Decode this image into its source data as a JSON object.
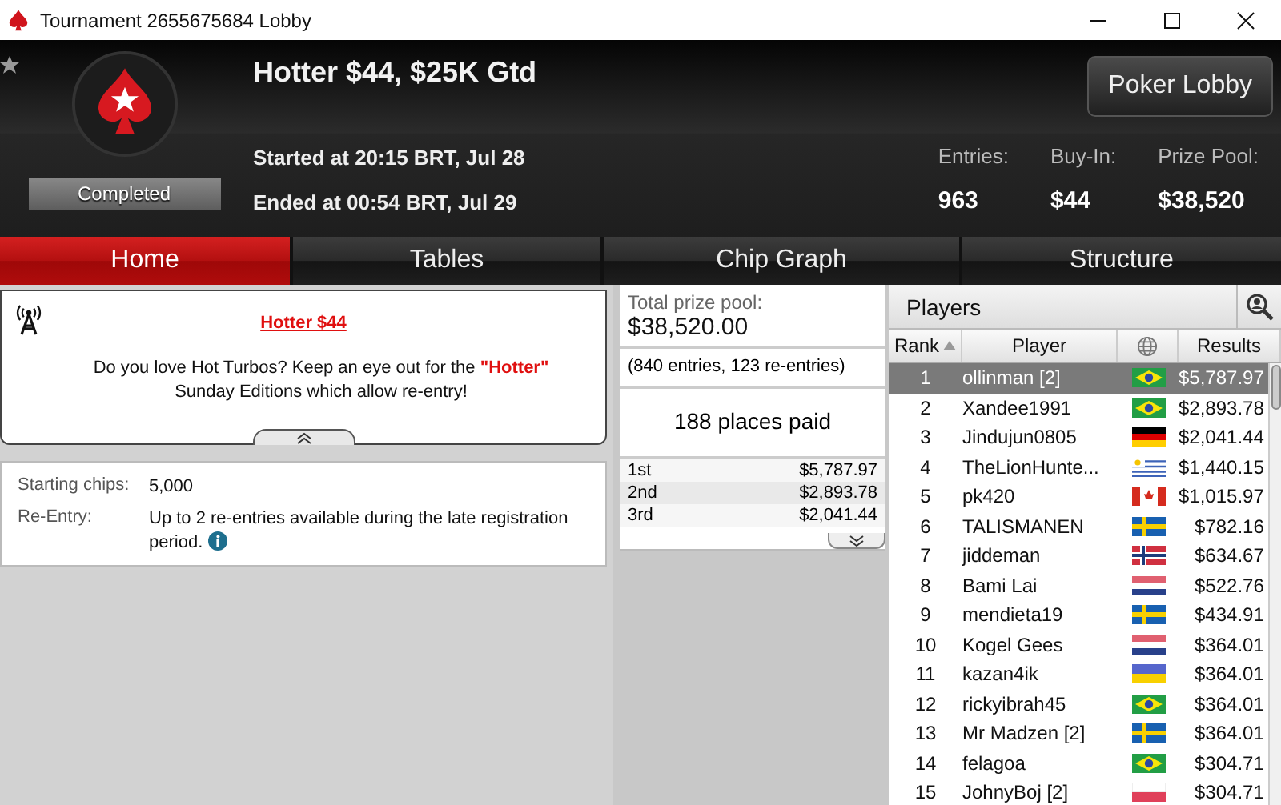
{
  "window": {
    "title": "Tournament 2655675684 Lobby"
  },
  "header": {
    "title": "Hotter $44, $25K Gtd",
    "status": "Completed",
    "started": "Started at 20:15 BRT, Jul 28",
    "ended": "Ended at 00:54 BRT, Jul 29",
    "lobby_button": "Poker Lobby",
    "stats": [
      {
        "label": "Entries:",
        "value": "963"
      },
      {
        "label": "Buy-In:",
        "value": "$44"
      },
      {
        "label": "Prize Pool:",
        "value": "$38,520"
      }
    ]
  },
  "tabs": [
    {
      "label": "Home",
      "selected": true
    },
    {
      "label": "Tables",
      "selected": false
    },
    {
      "label": "Chip Graph",
      "selected": false
    },
    {
      "label": "Structure",
      "selected": false
    }
  ],
  "announcement": {
    "title": "Hotter $44",
    "message": "Do you love Hot Turbos? Keep an eye out for the **\"Hotter\"** Sunday Editions which allow re-entry!"
  },
  "details": [
    {
      "label": "Starting chips:",
      "value": "5,000",
      "info": false
    },
    {
      "label": "Re-Entry:",
      "value": "Up to 2 re-entries available during the late registration period.",
      "info": true
    }
  ],
  "prizes": {
    "label": "Total prize pool:",
    "total": "$38,520.00",
    "entries": "(840 entries, 123 re-entries)",
    "places_paid": "188 places paid",
    "rows": [
      {
        "place": "1st",
        "amount": "$5,787.97"
      },
      {
        "place": "2nd",
        "amount": "$2,893.78"
      },
      {
        "place": "3rd",
        "amount": "$2,041.44"
      }
    ]
  },
  "players": {
    "title": "Players",
    "columns": [
      "Rank",
      "Player",
      "Results"
    ],
    "rows": [
      {
        "rank": "1",
        "player": "ollinman [2]",
        "kind": "br",
        "result": "$5,787.97",
        "selected": true
      },
      {
        "rank": "2",
        "player": "Xandee1991",
        "kind": "br",
        "result": "$2,893.78",
        "selected": false
      },
      {
        "rank": "3",
        "player": "Jindujun0805",
        "kind": "de",
        "result": "$2,041.44",
        "selected": false
      },
      {
        "rank": "4",
        "player": "TheLionHunte...",
        "kind": "uy",
        "result": "$1,440.15",
        "selected": false
      },
      {
        "rank": "5",
        "player": "pk420",
        "kind": "ca",
        "result": "$1,015.97",
        "selected": false
      },
      {
        "rank": "6",
        "player": "TALISMANEN",
        "kind": "se",
        "result": "$782.16",
        "selected": false
      },
      {
        "rank": "7",
        "player": "jiddeman",
        "kind": "no",
        "result": "$634.67",
        "selected": false
      },
      {
        "rank": "8",
        "player": "Bami Lai",
        "kind": "nl",
        "result": "$522.76",
        "selected": false
      },
      {
        "rank": "9",
        "player": "mendieta19",
        "kind": "se",
        "result": "$434.91",
        "selected": false
      },
      {
        "rank": "10",
        "player": "Kogel Gees",
        "kind": "nl",
        "result": "$364.01",
        "selected": false
      },
      {
        "rank": "11",
        "player": "kazan4ik",
        "kind": "ua",
        "result": "$364.01",
        "selected": false
      },
      {
        "rank": "12",
        "player": "rickyibrah45",
        "kind": "br",
        "result": "$364.01",
        "selected": false
      },
      {
        "rank": "13",
        "player": "Mr Madzen [2]",
        "kind": "se",
        "result": "$364.01",
        "selected": false
      },
      {
        "rank": "14",
        "player": "felagoa",
        "kind": "br",
        "result": "$304.71",
        "selected": false
      },
      {
        "rank": "15",
        "player": "JohnyBoj [2]",
        "kind": "pl",
        "result": "$304.71",
        "selected": false
      }
    ]
  }
}
